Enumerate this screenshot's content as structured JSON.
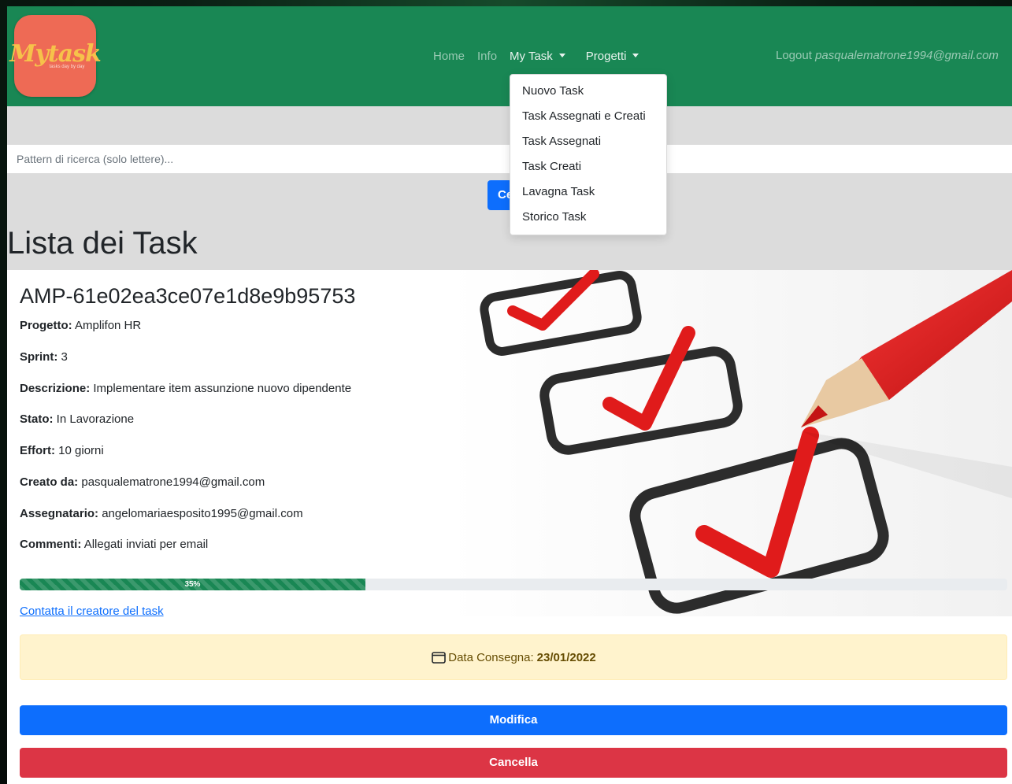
{
  "navbar": {
    "logo_text": "Mytask",
    "logo_subtext": "tasks day by day",
    "links": {
      "home": "Home",
      "info": "Info",
      "my_task": "My Task",
      "progetti": "Progetti"
    },
    "logout_label": "Logout",
    "user_email": "pasqualematrone1994@gmail.com"
  },
  "dropdown": {
    "items": [
      "Nuovo Task",
      "Task Assegnati e Creati",
      "Task Assegnati",
      "Task Creati",
      "Lavagna Task",
      "Storico Task"
    ]
  },
  "search": {
    "placeholder": "Pattern di ricerca (solo lettere)...",
    "button_label": "Cerca"
  },
  "page_title": "Lista dei Task",
  "task": {
    "id": "AMP-61e02ea3ce07e1d8e9b95753",
    "fields": [
      {
        "label": "Progetto:",
        "value": "Amplifon HR"
      },
      {
        "label": "Sprint:",
        "value": "3"
      },
      {
        "label": "Descrizione:",
        "value": "Implementare item assunzione nuovo dipendente"
      },
      {
        "label": "Stato:",
        "value": "In Lavorazione"
      },
      {
        "label": "Effort:",
        "value": "10 giorni"
      },
      {
        "label": "Creato da:",
        "value": "pasqualematrone1994@gmail.com"
      },
      {
        "label": "Assegnatario:",
        "value": "angelomariaesposito1995@gmail.com"
      },
      {
        "label": "Commenti:",
        "value": "Allegati inviati per email"
      }
    ],
    "progress_percent": 35,
    "progress_label": "35%",
    "contact_link": "Contatta il creatore del task",
    "delivery_label": "Data Consegna:",
    "delivery_date": "23/01/2022",
    "edit_button": "Modifica",
    "delete_button": "Cancella"
  },
  "colors": {
    "navbar": "#198754",
    "primary": "#0d6efd",
    "danger": "#dc3545",
    "warning_bg": "#fff3cd",
    "logo_bg": "#ee6a55"
  }
}
